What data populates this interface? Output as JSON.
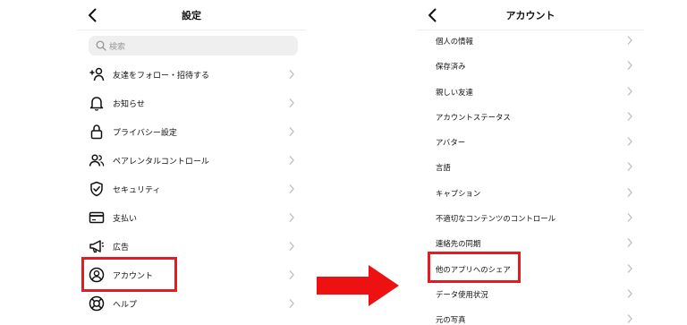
{
  "colors": {
    "highlight": "#e51b22",
    "arrow": "#ee1111",
    "search_background": "#efefef",
    "chevron": "#bdbdbd",
    "text": "#111111"
  },
  "settings": {
    "title": "設定",
    "back_icon": "back-chevron-icon",
    "search_placeholder": "検索",
    "items": [
      {
        "label": "友達をフォロー・招待する",
        "icon": "add-person-icon"
      },
      {
        "label": "お知らせ",
        "icon": "bell-icon"
      },
      {
        "label": "プライバシー設定",
        "icon": "lock-icon"
      },
      {
        "label": "ペアレンタルコントロール",
        "icon": "people-icon"
      },
      {
        "label": "セキュリティ",
        "icon": "shield-check-icon"
      },
      {
        "label": "支払い",
        "icon": "credit-card-icon"
      },
      {
        "label": "広告",
        "icon": "megaphone-icon"
      },
      {
        "label": "アカウント",
        "icon": "account-circle-icon",
        "highlighted": true
      },
      {
        "label": "ヘルプ",
        "icon": "lifebuoy-icon"
      }
    ]
  },
  "account": {
    "title": "アカウント",
    "back_icon": "back-chevron-icon",
    "items": [
      {
        "label": "個人の情報"
      },
      {
        "label": "保存済み"
      },
      {
        "label": "親しい友達"
      },
      {
        "label": "アカウントステータス"
      },
      {
        "label": "アバター"
      },
      {
        "label": "言語"
      },
      {
        "label": "キャプション"
      },
      {
        "label": "不適切なコンテンツのコントロール"
      },
      {
        "label": "連絡先の同期"
      },
      {
        "label": "他のアプリへのシェア",
        "highlighted": true
      },
      {
        "label": "データ使用状況"
      },
      {
        "label": "元の写真"
      }
    ]
  }
}
